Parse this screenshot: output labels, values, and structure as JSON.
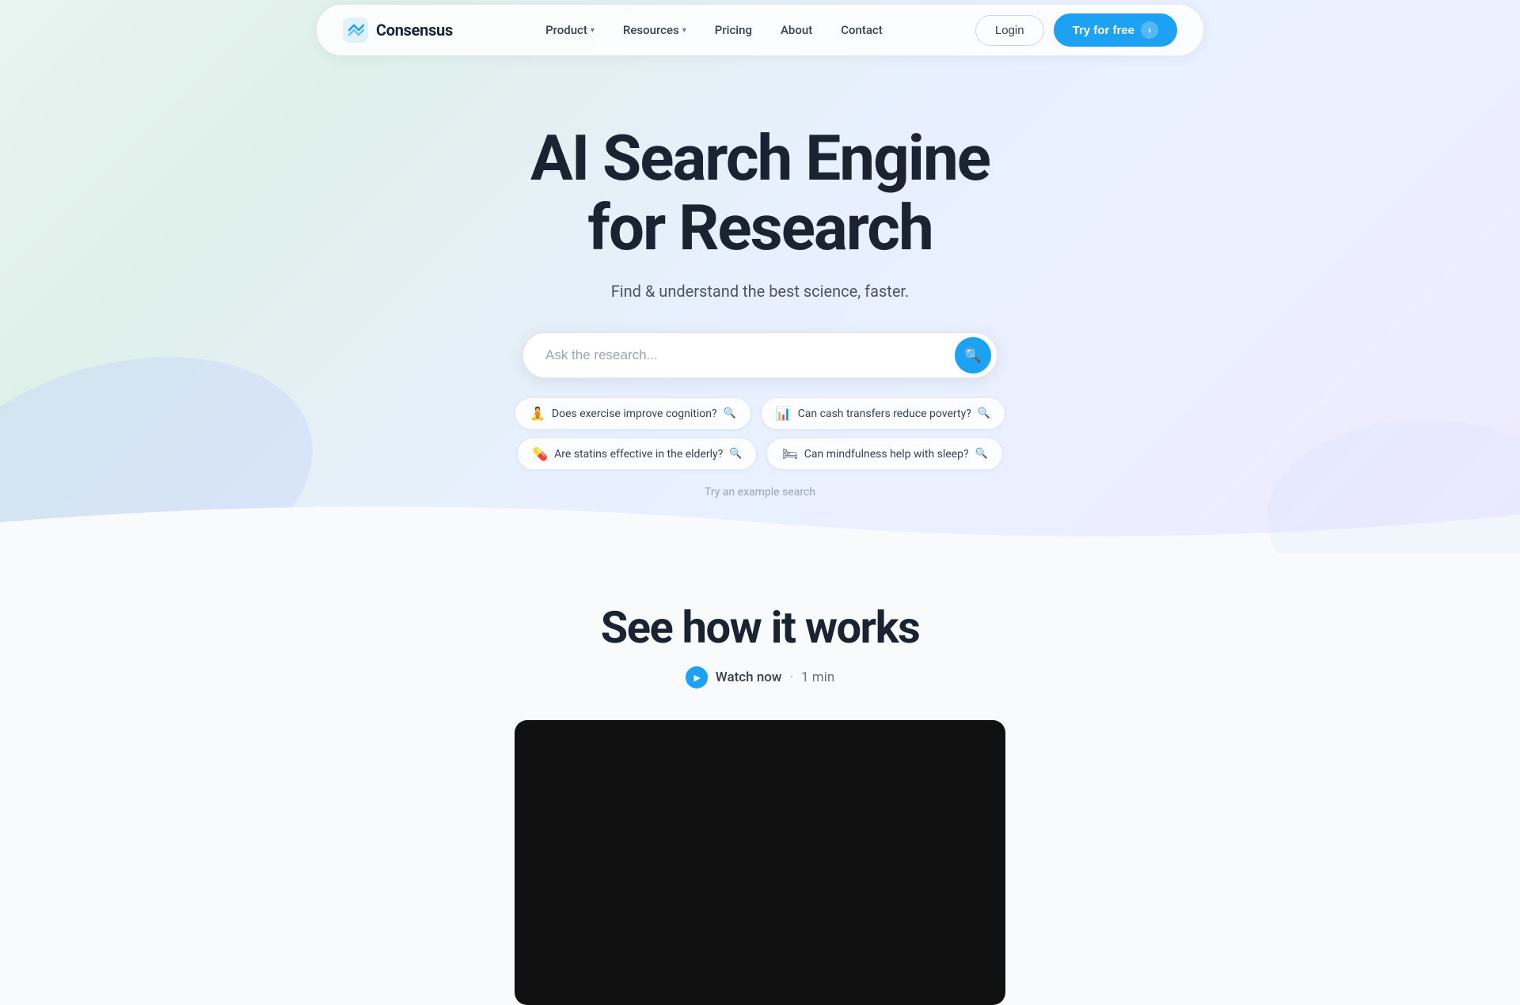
{
  "navbar": {
    "logo_text": "Consensus",
    "links": [
      {
        "label": "Product",
        "has_dropdown": true
      },
      {
        "label": "Resources",
        "has_dropdown": true
      },
      {
        "label": "Pricing",
        "has_dropdown": false
      },
      {
        "label": "About",
        "has_dropdown": false
      },
      {
        "label": "Contact",
        "has_dropdown": false
      }
    ],
    "login_label": "Login",
    "try_label": "Try for free"
  },
  "hero": {
    "title_line1": "AI Search Engine",
    "title_line2": "for Research",
    "subtitle": "Find & understand the best science, faster.",
    "search_placeholder": "Ask the research...",
    "example_searches": [
      {
        "icon": "🧘",
        "text": "Does exercise improve cognition?"
      },
      {
        "icon": "📊",
        "text": "Can cash transfers reduce poverty?"
      },
      {
        "icon": "💊",
        "text": "Are statins effective in the elderly?"
      },
      {
        "icon": "🛏",
        "text": "Can mindfulness help with sleep?"
      }
    ],
    "try_example_label": "Try an example search"
  },
  "video_section": {
    "title": "See how it works",
    "watch_label": "Watch now",
    "duration": "1 min"
  }
}
